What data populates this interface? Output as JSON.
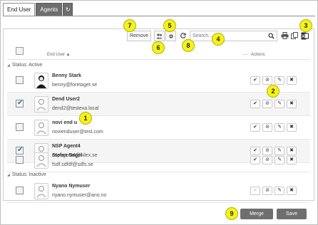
{
  "tabs": [
    {
      "label": "End User"
    },
    {
      "label": "Agents"
    },
    {
      "label": "↻"
    }
  ],
  "toolbar": {
    "remove_label": "Remove",
    "search_placeholder": "Search..."
  },
  "table": {
    "col_user": "End User ▲",
    "col_actions": "Actions",
    "col_sep": "—"
  },
  "groups": [
    {
      "label": "Status: Active"
    },
    {
      "label": "Status: Inactive"
    }
  ],
  "rows": [
    {
      "name": "Benny Stark",
      "email": "benny@foretaget.se",
      "checked": false
    },
    {
      "name": "Dend User2",
      "email": "dend2@testexa.local",
      "checked": true
    },
    {
      "name": "novi end u",
      "email": "novienduser@test.com",
      "checked": false
    },
    {
      "name": "NSP Agent4",
      "email": "nspagent4@nilex.se",
      "checked": true
    },
    {
      "name": "Stefan Segel",
      "email": "fsdf.sdfdf@sdfs.se",
      "checked": false
    },
    {
      "name": "Nyano Nymuser",
      "email": "nyano.nymuser@ano.no",
      "checked": false
    }
  ],
  "actions": {
    "approve": "✔",
    "block": "⊘",
    "edit": "✎",
    "delete": "✖"
  },
  "footer": {
    "merge_label": "Merge",
    "save_label": "Save"
  },
  "callouts": [
    "1",
    "2",
    "3",
    "4",
    "5",
    "6",
    "7",
    "8",
    "9"
  ],
  "colors": {
    "callout": "#f4f21a",
    "button_dark": "#6f6f6f",
    "check_blue": "#2c6fb8"
  }
}
